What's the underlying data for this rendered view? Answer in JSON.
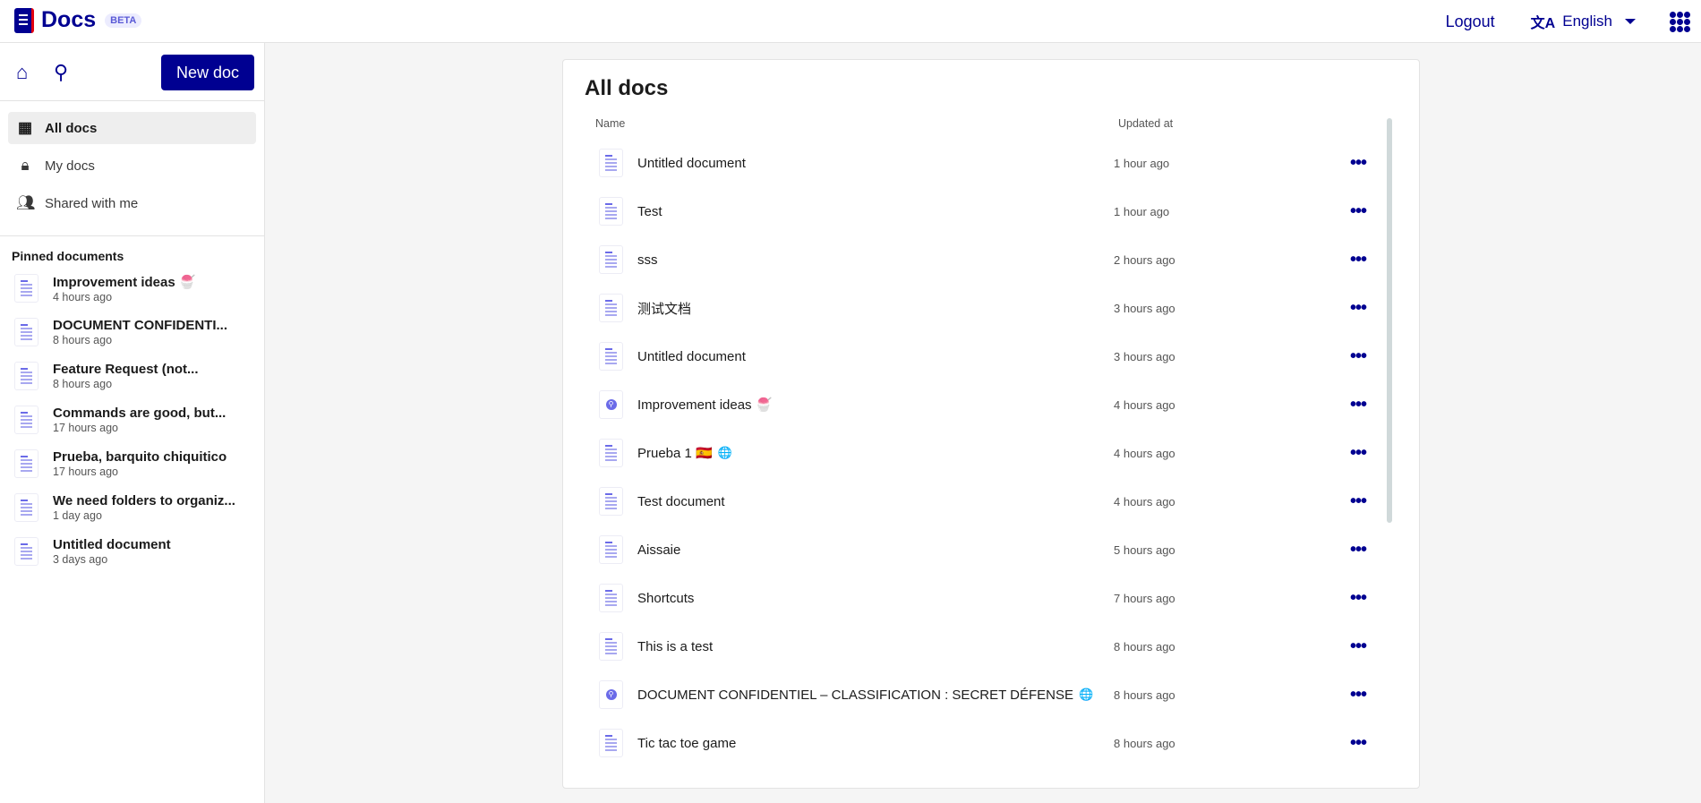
{
  "header": {
    "app_name": "Docs",
    "badge": "BETA",
    "logout": "Logout",
    "language": "English"
  },
  "sidebar": {
    "new_doc": "New doc",
    "nav": [
      {
        "label": "All docs",
        "icon": "grid-icon"
      },
      {
        "label": "My docs",
        "icon": "lock-icon"
      },
      {
        "label": "Shared with me",
        "icon": "people-icon"
      }
    ],
    "pinned_title": "Pinned documents",
    "pinned": [
      {
        "name": "Improvement ideas 🍧",
        "date": "4 hours ago"
      },
      {
        "name": "DOCUMENT CONFIDENTI...",
        "date": "8 hours ago"
      },
      {
        "name": "Feature Request (not...",
        "date": "8 hours ago"
      },
      {
        "name": "Commands are good, but...",
        "date": "17 hours ago"
      },
      {
        "name": "Prueba, barquito chiquitico",
        "date": "17 hours ago"
      },
      {
        "name": "We need folders to organiz...",
        "date": "1 day ago"
      },
      {
        "name": "Untitled document",
        "date": "3 days ago"
      }
    ]
  },
  "main": {
    "title": "All docs",
    "col_name": "Name",
    "col_updated": "Updated at",
    "rows": [
      {
        "name": "Untitled document",
        "date": "1 hour ago",
        "pinned": false,
        "globe": ""
      },
      {
        "name": "Test",
        "date": "1 hour ago",
        "pinned": false,
        "globe": ""
      },
      {
        "name": "sss",
        "date": "2 hours ago",
        "pinned": false,
        "globe": ""
      },
      {
        "name": "测试文档",
        "date": "3 hours ago",
        "pinned": false,
        "globe": ""
      },
      {
        "name": "Untitled document",
        "date": "3 hours ago",
        "pinned": false,
        "globe": ""
      },
      {
        "name": "Improvement ideas 🍧",
        "date": "4 hours ago",
        "pinned": true,
        "globe": ""
      },
      {
        "name": "Prueba 1 🇪🇸",
        "date": "4 hours ago",
        "pinned": false,
        "globe": "🌐"
      },
      {
        "name": "Test document",
        "date": "4 hours ago",
        "pinned": false,
        "globe": ""
      },
      {
        "name": "Aissaie",
        "date": "5 hours ago",
        "pinned": false,
        "globe": ""
      },
      {
        "name": "Shortcuts",
        "date": "7 hours ago",
        "pinned": false,
        "globe": ""
      },
      {
        "name": "This is a test",
        "date": "8 hours ago",
        "pinned": false,
        "globe": ""
      },
      {
        "name": "DOCUMENT CONFIDENTIEL – CLASSIFICATION : SECRET DÉFENSE",
        "date": "8 hours ago",
        "pinned": true,
        "globe": "🌐"
      },
      {
        "name": "Tic tac toe game",
        "date": "8 hours ago",
        "pinned": false,
        "globe": ""
      }
    ],
    "more": "•••"
  }
}
